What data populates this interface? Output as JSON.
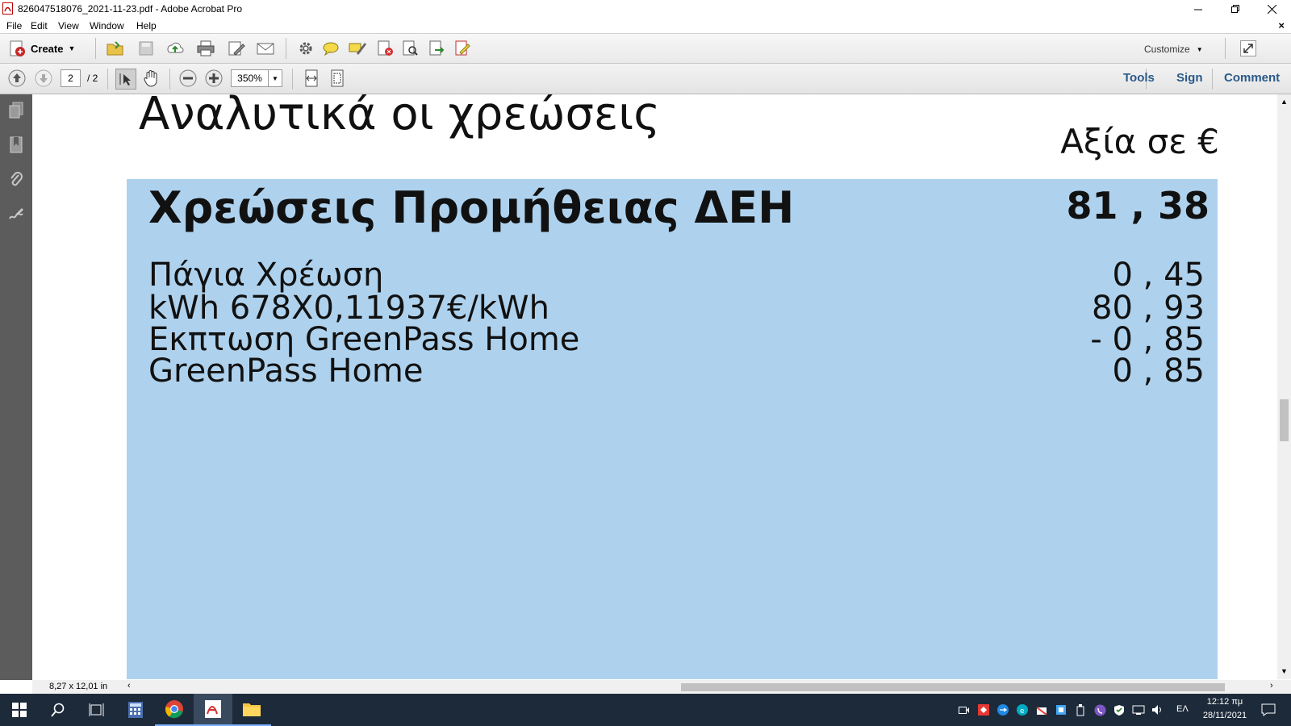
{
  "window": {
    "title": "826047518076_2021-11-23.pdf - Adobe Acrobat Pro",
    "doc_close": "×"
  },
  "menu": [
    "File",
    "Edit",
    "View",
    "Window",
    "Help"
  ],
  "toolbar1": {
    "create_label": "Create",
    "customize_label": "Customize"
  },
  "toolbar2": {
    "page_current": "2",
    "page_total": "/ 2",
    "zoom": "350%",
    "tools_label": "Tools",
    "sign_label": "Sign",
    "comment_label": "Comment"
  },
  "document": {
    "heading": "Αναλυτικά οι χρεώσεις",
    "value_header": "Αξία σε €",
    "section_title": "Χρεώσεις Προμήθειας ΔΕΗ",
    "section_total": "81 , 38",
    "rows": [
      {
        "label": "Πάγια Χρέωση",
        "value": "0 , 45"
      },
      {
        "label": "kWh 678Χ0,11937€/kWh",
        "value": "80 , 93"
      },
      {
        "label": "Εκπτωση GreenPass Home",
        "value": "- 0 , 85"
      },
      {
        "label": "GreenPass Home",
        "value": "0 , 85"
      }
    ]
  },
  "status": {
    "page_size": "8,27 x 12,01 in"
  },
  "taskbar": {
    "language": "ΕΛ",
    "time": "12:12 πμ",
    "date": "28/11/2021"
  },
  "colors": {
    "blue_panel": "#aed2ee",
    "taskbar": "#1d2a3a",
    "left_nav": "#5c5c5c"
  }
}
